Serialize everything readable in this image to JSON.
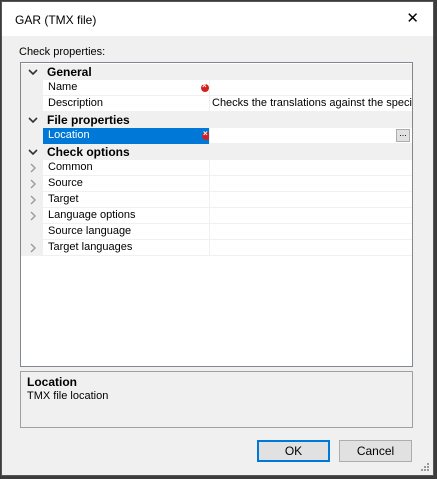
{
  "window": {
    "title": "GAR (TMX file)"
  },
  "check_properties_label": "Check properties:",
  "grid": {
    "categories": {
      "general": "General",
      "file_properties": "File properties",
      "check_options": "Check options"
    },
    "general": {
      "name_label": "Name",
      "name_value": "",
      "description_label": "Description",
      "description_value": "Checks the translations against the specifie"
    },
    "file_properties": {
      "location_label": "Location",
      "location_value": "",
      "browse_label": "..."
    },
    "check_options": {
      "items": [
        "Common",
        "Source",
        "Target",
        "Language options",
        "Source language",
        "Target languages"
      ]
    }
  },
  "help": {
    "title": "Location",
    "description": "TMX file location"
  },
  "buttons": {
    "ok": "OK",
    "cancel": "Cancel"
  },
  "colors": {
    "selection": "#0078d7",
    "error": "#d32020"
  }
}
